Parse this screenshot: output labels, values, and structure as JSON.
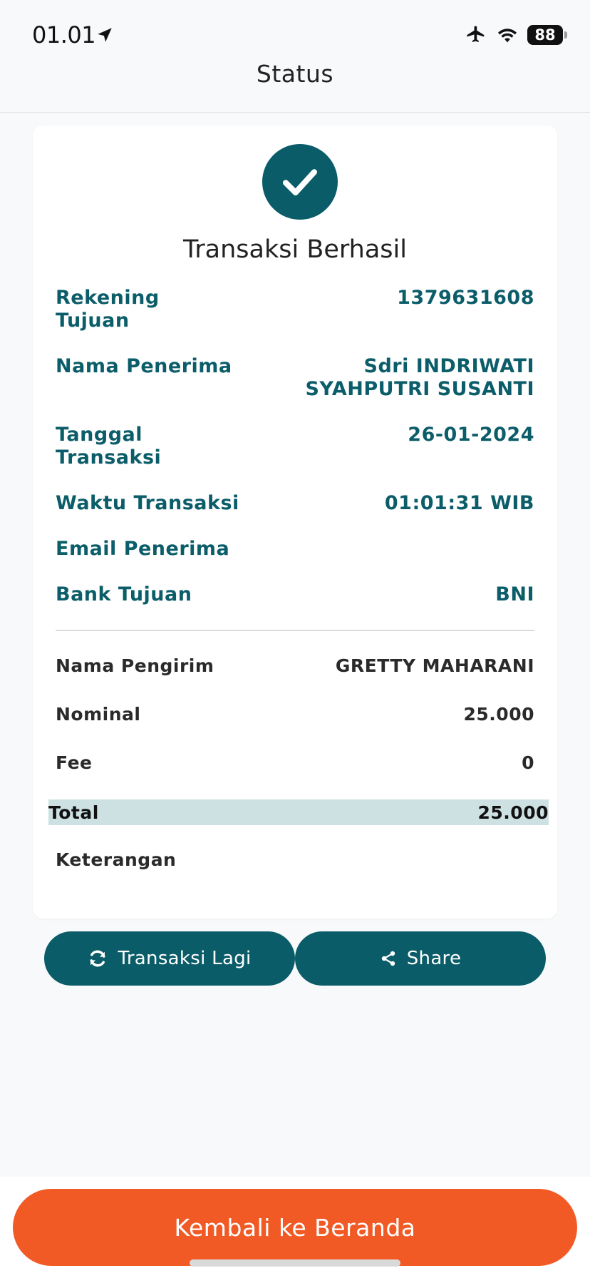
{
  "status_bar": {
    "time": "01.01",
    "battery": "88",
    "icons": [
      "location-arrow-icon",
      "airplane-icon",
      "wifi-icon",
      "battery-icon"
    ]
  },
  "header": {
    "title": "Status"
  },
  "receipt": {
    "status_title": "Transaksi Berhasil",
    "details": [
      {
        "label_line1": "Rekening",
        "label_line2": "Tujuan",
        "value": "1379631608"
      },
      {
        "label": "Nama Penerima",
        "value_line1": "Sdri INDRIWATI",
        "value_line2": "SYAHPUTRI SUSANTI"
      },
      {
        "label_line1": "Tanggal",
        "label_line2": "Transaksi",
        "value": "26-01-2024"
      },
      {
        "label": "Waktu Transaksi",
        "value": "01:01:31 WIB"
      },
      {
        "label": "Email Penerima",
        "value": ""
      },
      {
        "label": "Bank Tujuan",
        "value": "BNI"
      }
    ],
    "sender_label": "Nama Pengirim",
    "sender_value": "GRETTY MAHARANI",
    "nominal_label": "Nominal",
    "nominal_value": "25.000",
    "fee_label": "Fee",
    "fee_value": "0",
    "total_label": "Total",
    "total_value": "25.000",
    "note_label": "Keterangan",
    "note_value": ""
  },
  "actions": {
    "again_label": "Transaksi Lagi",
    "share_label": "Share"
  },
  "footer": {
    "home_label": "Kembali ke Beranda"
  },
  "colors": {
    "teal": "#0a5c68",
    "orange": "#f15a24",
    "total_bg": "#cde0e2"
  }
}
